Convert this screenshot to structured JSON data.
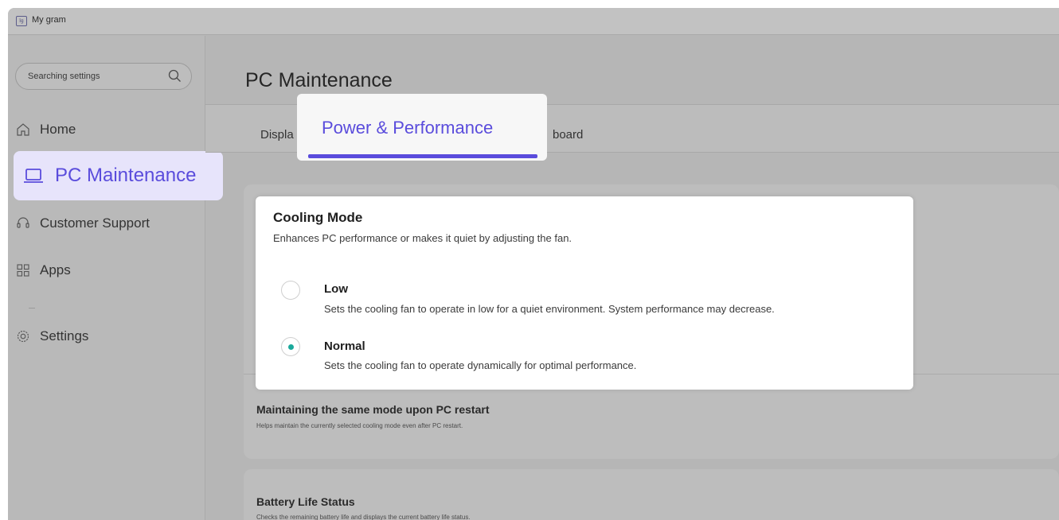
{
  "window": {
    "title": "My gram",
    "logo_text": "lg"
  },
  "sidebar": {
    "search_placeholder": "Searching settings",
    "items": [
      {
        "label": "Home",
        "icon": "home-icon"
      },
      {
        "label": "PC Maintenance",
        "icon": "laptop-icon",
        "active": true
      },
      {
        "label": "Customer Support",
        "icon": "headset-icon"
      },
      {
        "label": "Apps",
        "icon": "grid-icon"
      },
      {
        "label": "Settings",
        "icon": "gear-icon"
      }
    ]
  },
  "main": {
    "page_title": "PC Maintenance",
    "tabs": [
      {
        "label": "Displa"
      },
      {
        "label": "Power & Performance",
        "active": true
      },
      {
        "label": "board"
      }
    ],
    "maintain": {
      "title": "Maintaining the same mode upon PC restart",
      "desc": "Helps maintain the currently selected cooling mode even after PC restart."
    },
    "battery": {
      "title": "Battery Life Status",
      "desc": "Checks the remaining battery life and displays the current battery life status."
    }
  },
  "cooling_popup": {
    "title": "Cooling Mode",
    "desc": "Enhances PC performance or makes it quiet by adjusting the fan.",
    "options": [
      {
        "label": "Low",
        "desc": "Sets the cooling fan to operate in low for a quiet environment. System performance may decrease.",
        "selected": false
      },
      {
        "label": "Normal",
        "desc": "Sets the cooling fan to operate dynamically for optimal performance.",
        "selected": true
      }
    ]
  },
  "colors": {
    "accent": "#5a4cdc",
    "radio_selected": "#1aa99b",
    "overlay": "#b6b6b6"
  }
}
